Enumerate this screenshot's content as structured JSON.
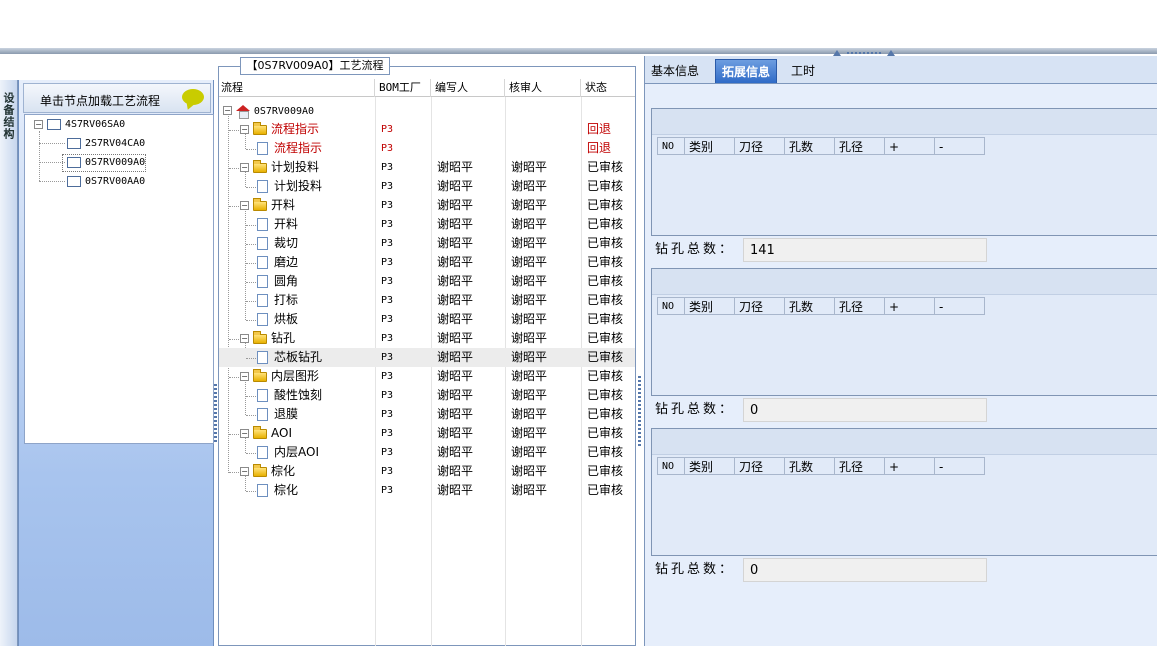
{
  "left_vtab": {
    "label": "设备结构"
  },
  "left_panel": {
    "header": "单击节点加载工艺流程",
    "tree": {
      "root": "4S7RV06SA0",
      "children": [
        "2S7RV04CA0",
        "0S7RV009A0",
        "0S7RV00AA0"
      ]
    }
  },
  "middle_panel": {
    "caption": "【0S7RV009A0】工艺流程",
    "columns": [
      "流程",
      "BOM工厂",
      "编写人",
      "核审人",
      "状态"
    ],
    "root": "0S7RV009A0",
    "rows": [
      {
        "name": "流程指示",
        "bom": "P3",
        "writer": "",
        "reviewer": "",
        "status": "回退"
      },
      {
        "name": "流程指示",
        "bom": "P3",
        "writer": "",
        "reviewer": "",
        "status": "回退"
      },
      {
        "name": "计划投料",
        "bom": "P3",
        "writer": "谢昭平",
        "reviewer": "谢昭平",
        "status": "已审核"
      },
      {
        "name": "计划投料",
        "bom": "P3",
        "writer": "谢昭平",
        "reviewer": "谢昭平",
        "status": "已审核"
      },
      {
        "name": "开料",
        "bom": "P3",
        "writer": "谢昭平",
        "reviewer": "谢昭平",
        "status": "已审核"
      },
      {
        "name": "开料",
        "bom": "P3",
        "writer": "谢昭平",
        "reviewer": "谢昭平",
        "status": "已审核"
      },
      {
        "name": "裁切",
        "bom": "P3",
        "writer": "谢昭平",
        "reviewer": "谢昭平",
        "status": "已审核"
      },
      {
        "name": "磨边",
        "bom": "P3",
        "writer": "谢昭平",
        "reviewer": "谢昭平",
        "status": "已审核"
      },
      {
        "name": "圆角",
        "bom": "P3",
        "writer": "谢昭平",
        "reviewer": "谢昭平",
        "status": "已审核"
      },
      {
        "name": "打标",
        "bom": "P3",
        "writer": "谢昭平",
        "reviewer": "谢昭平",
        "status": "已审核"
      },
      {
        "name": "烘板",
        "bom": "P3",
        "writer": "谢昭平",
        "reviewer": "谢昭平",
        "status": "已审核"
      },
      {
        "name": "钻孔",
        "bom": "P3",
        "writer": "谢昭平",
        "reviewer": "谢昭平",
        "status": "已审核"
      },
      {
        "name": "芯板钻孔",
        "bom": "P3",
        "writer": "谢昭平",
        "reviewer": "谢昭平",
        "status": "已审核"
      },
      {
        "name": "内层图形",
        "bom": "P3",
        "writer": "谢昭平",
        "reviewer": "谢昭平",
        "status": "已审核"
      },
      {
        "name": "酸性蚀刻",
        "bom": "P3",
        "writer": "谢昭平",
        "reviewer": "谢昭平",
        "status": "已审核"
      },
      {
        "name": "退膜",
        "bom": "P3",
        "writer": "谢昭平",
        "reviewer": "谢昭平",
        "status": "已审核"
      },
      {
        "name": "AOI",
        "bom": "P3",
        "writer": "谢昭平",
        "reviewer": "谢昭平",
        "status": "已审核"
      },
      {
        "name": "内层AOI",
        "bom": "P3",
        "writer": "谢昭平",
        "reviewer": "谢昭平",
        "status": "已审核"
      },
      {
        "name": "棕化",
        "bom": "P3",
        "writer": "谢昭平",
        "reviewer": "谢昭平",
        "status": "已审核"
      },
      {
        "name": "棕化",
        "bom": "P3",
        "writer": "谢昭平",
        "reviewer": "谢昭平",
        "status": "已审核"
      }
    ]
  },
  "right_panel": {
    "tabs": [
      "基本信息",
      "拓展信息",
      "工时"
    ],
    "active_tab": "拓展信息",
    "sections": [
      {
        "columns": [
          "NO",
          "类别",
          "刀径",
          "孔数",
          "孔径",
          "+",
          "-"
        ],
        "count_label": "钻孔总数：",
        "count_value": "141"
      },
      {
        "columns": [
          "NO",
          "类别",
          "刀径",
          "孔数",
          "孔径",
          "+",
          "-"
        ],
        "count_label": "钻孔总数：",
        "count_value": "0"
      },
      {
        "columns": [
          "NO",
          "类别",
          "刀径",
          "孔数",
          "孔径",
          "+",
          "-"
        ],
        "count_label": "钻孔总数：",
        "count_value": "0"
      }
    ]
  }
}
